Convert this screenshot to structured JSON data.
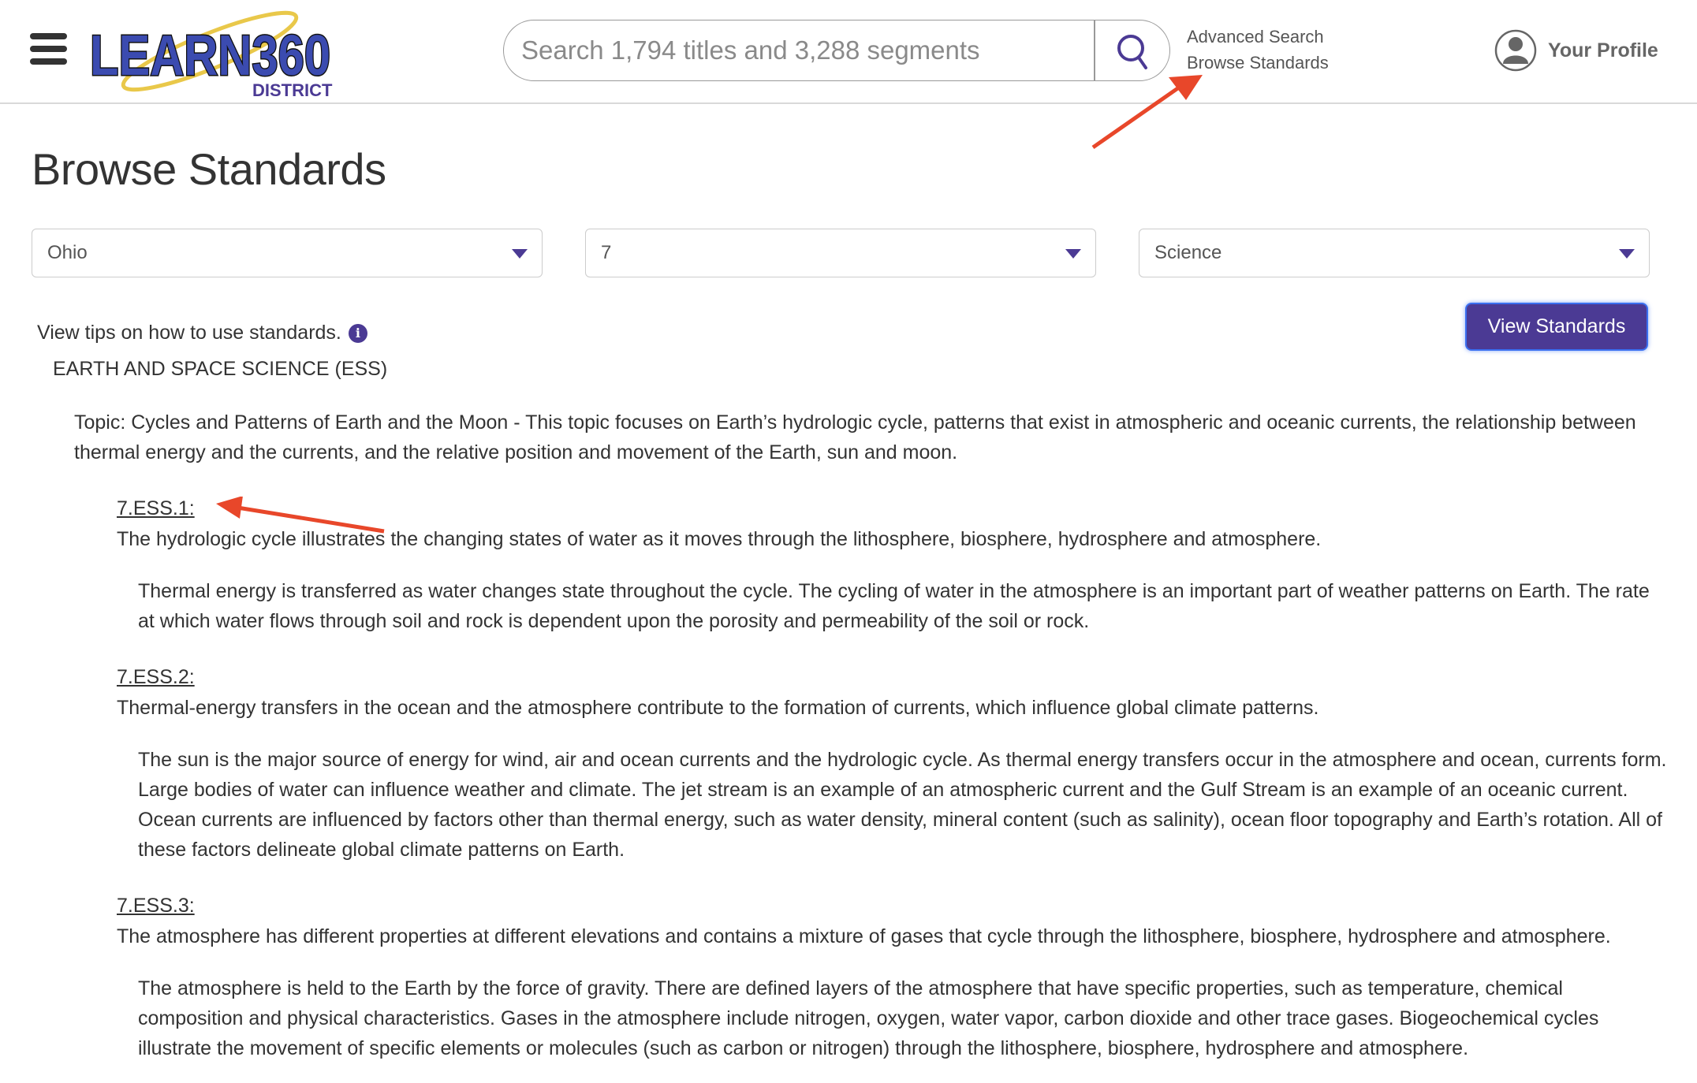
{
  "header": {
    "menu_icon": "hamburger-icon",
    "logo": {
      "main": "LEARN360",
      "sub": "DISTRICT"
    },
    "search": {
      "placeholder": "Search 1,794 titles and 3,288 segments",
      "value": "",
      "icon": "search-icon"
    },
    "links": {
      "advanced_search": "Advanced Search",
      "browse_standards": "Browse Standards"
    },
    "profile": {
      "label": "Your Profile",
      "icon": "user-avatar-icon"
    }
  },
  "page": {
    "title": "Browse Standards",
    "filters": {
      "state": "Ohio",
      "grade": "7",
      "subject": "Science"
    },
    "view_button": "View Standards",
    "tips": "View tips on how to use standards.",
    "tips_icon": "info-icon",
    "strand": "EARTH AND SPACE SCIENCE (ESS)",
    "topic": "Topic: Cycles and Patterns of Earth and the Moon - This topic focuses on Earth’s hydrologic cycle, patterns that exist in atmospheric and oceanic currents, the relationship between thermal energy and the currents, and the relative position and movement of the Earth, sun and moon.",
    "standards": [
      {
        "code": "7.ESS.1:",
        "statement": "The hydrologic cycle illustrates the changing states of water as it moves through the lithosphere, biosphere, hydrosphere and atmosphere.",
        "elaboration": "Thermal energy is transferred as water changes state throughout the cycle. The cycling of water in the atmosphere is an important part of weather patterns on Earth. The rate at which water flows through soil and rock is dependent upon the porosity and permeability of the soil or rock."
      },
      {
        "code": "7.ESS.2:",
        "statement": "Thermal-energy transfers in the ocean and the atmosphere contribute to the formation of currents, which influence global climate patterns.",
        "elaboration": "The sun is the major source of energy for wind, air and ocean currents and the hydrologic cycle. As thermal energy transfers occur in the atmosphere and ocean, currents form. Large bodies of water can influence weather and climate. The jet stream is an example of an atmospheric current and the Gulf Stream is an example of an oceanic current. Ocean currents are influenced by factors other than thermal energy, such as water density, mineral content (such as salinity), ocean floor topography and Earth’s rotation. All of these factors delineate global climate patterns on Earth."
      },
      {
        "code": "7.ESS.3:",
        "statement": "The atmosphere has different properties at different elevations and contains a mixture of gases that cycle through the lithosphere, biosphere, hydrosphere and atmosphere.",
        "elaboration": "The atmosphere is held to the Earth by the force of gravity. There are defined layers of the atmosphere that have specific properties, such as temperature, chemical composition and physical characteristics. Gases in the atmosphere include nitrogen, oxygen, water vapor, carbon dioxide and other trace gases. Biogeochemical cycles illustrate the movement of specific elements or molecules (such as carbon or nitrogen) through the lithosphere, biosphere, hydrosphere and atmosphere."
      }
    ]
  },
  "colors": {
    "brand_purple": "#4b3a94",
    "annotation_red": "#e8472a",
    "focus_blue": "#3a6ff0"
  }
}
